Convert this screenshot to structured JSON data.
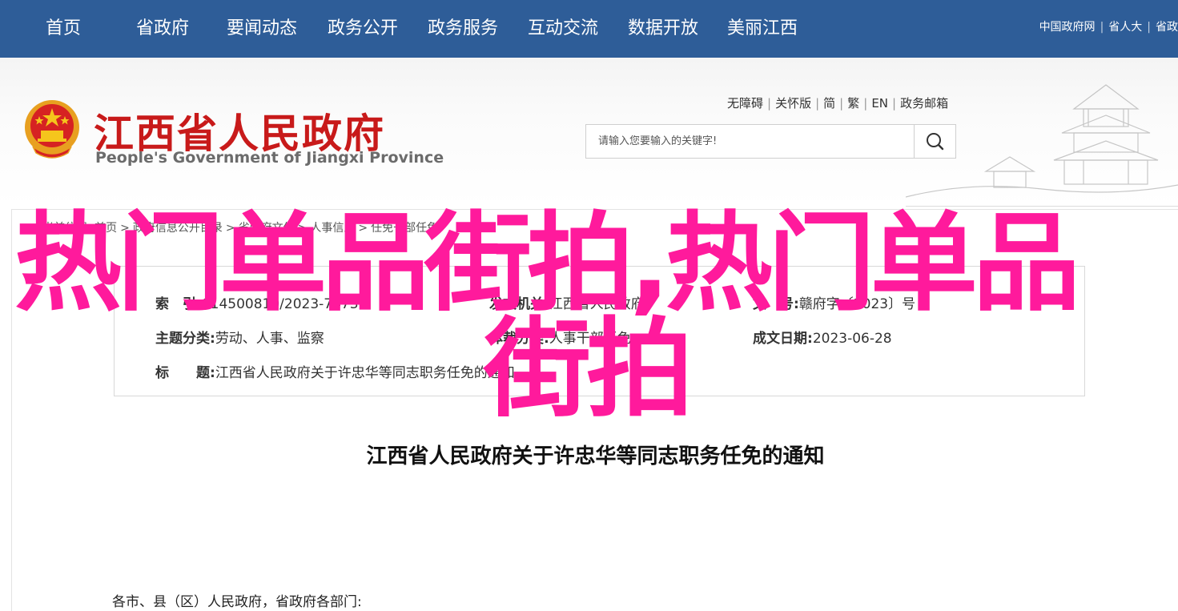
{
  "nav": {
    "items": [
      "首页",
      "省政府",
      "要闻动态",
      "政务公开",
      "政务服务",
      "互动交流",
      "数据开放",
      "美丽江西"
    ],
    "right_links": [
      "中国政府网",
      "省人大",
      "省政"
    ]
  },
  "header": {
    "title_cn": "江西省人民政府",
    "title_en": "People's Government of Jiangxi Province",
    "utility_links": [
      "无障碍",
      "关怀版",
      "简",
      "繁",
      "EN",
      "政务邮箱"
    ],
    "search_placeholder": "请输入您要输入的关键字!"
  },
  "breadcrumb": {
    "label": "当前位置:",
    "items": [
      "首页",
      "政府信息公开目录",
      "省政府文件",
      "人事信息",
      "任免干部任免"
    ]
  },
  "info": {
    "index_label": "索　引:",
    "index_value": "014500810/2023-74737",
    "publisher_label": "发文机关:",
    "publisher_value": "江西省人民政府",
    "docno_label": "文　号:",
    "docno_value": "赣府字〔2023〕号",
    "category_label": "主题分类:",
    "category_value": "劳动、人事、监察",
    "genre_label": "体裁分类:",
    "genre_value": "人事干部任免",
    "date_label": "成文日期:",
    "date_value": "2023-06-28",
    "title_label": "标　　题:",
    "title_value": "江西省人民政府关于许忠华等同志职务任免的通知"
  },
  "article": {
    "title": "江西省人民政府关于许忠华等同志职务任免的通知",
    "salutation": "各市、县（区）人民政府，省政府各部门:"
  },
  "overlay": {
    "line1": "热门单品街拍,热门单品",
    "line2": "街拍",
    "color": "#ff1a9c"
  },
  "colors": {
    "nav_bg": "#2e5d98",
    "title_red": "#c81a1a"
  }
}
